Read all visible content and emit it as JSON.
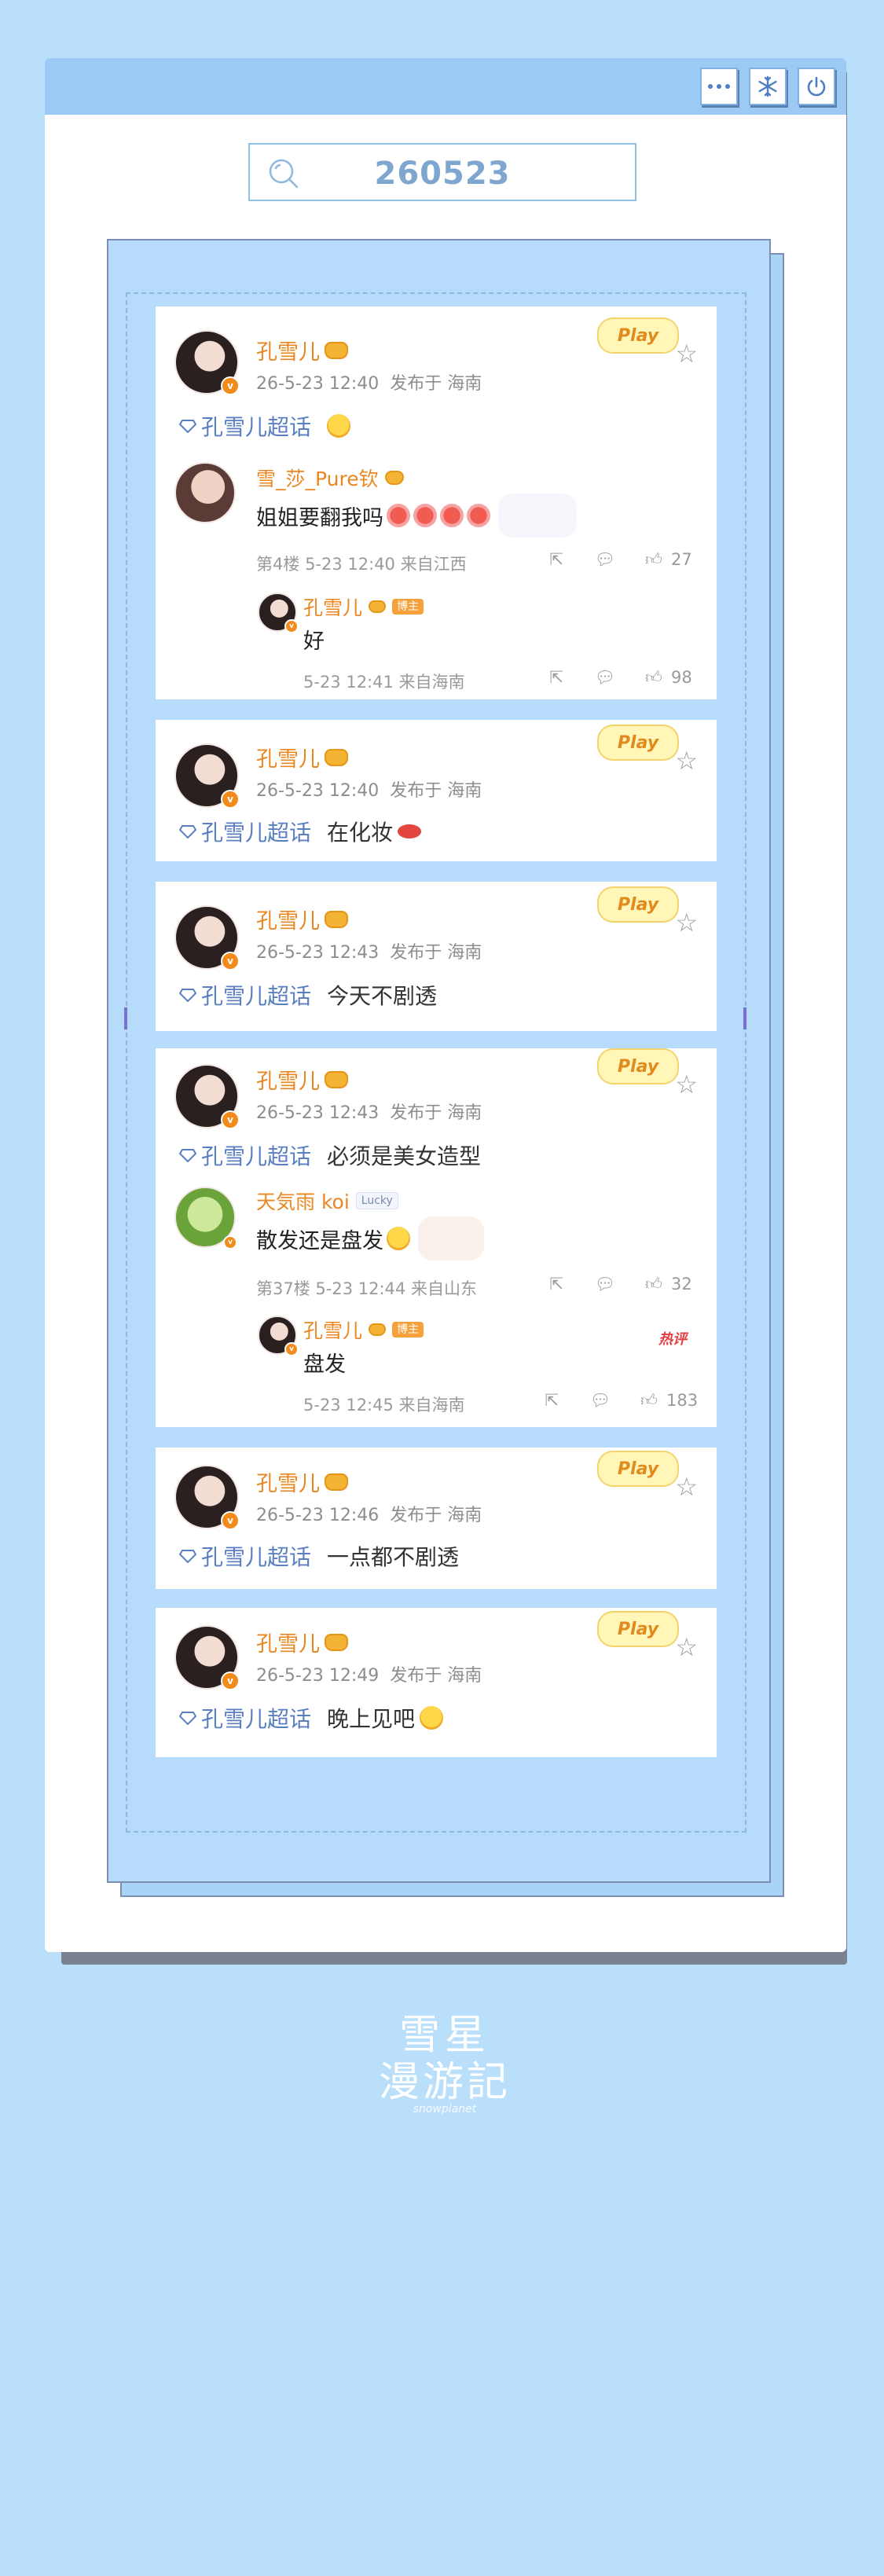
{
  "window": {
    "buttons": [
      "more-icon",
      "snowflake-icon",
      "power-icon"
    ]
  },
  "search": {
    "query": "260523"
  },
  "cards": [
    {
      "user": "孔雪儿",
      "time": "26-5-23 12:40",
      "loc": "发布于 海南",
      "topic": "孔雪儿超话",
      "text": "",
      "sticker": "Play",
      "comment": {
        "user": "雪_莎_Pure钦",
        "text": "姐姐要翻我吗",
        "floor": "第4楼",
        "time": "5-23 12:40",
        "from": "来自江西",
        "likes": "27",
        "reply": {
          "user": "孔雪儿",
          "tag": "博主",
          "text": "好",
          "time": "5-23 12:41",
          "from": "来自海南",
          "likes": "98"
        }
      }
    },
    {
      "user": "孔雪儿",
      "time": "26-5-23 12:40",
      "loc": "发布于 海南",
      "topic": "孔雪儿超话",
      "text": "在化妆",
      "sticker": "Play"
    },
    {
      "user": "孔雪儿",
      "time": "26-5-23 12:43",
      "loc": "发布于 海南",
      "topic": "孔雪儿超话",
      "text": "今天不剧透",
      "sticker": "Play"
    },
    {
      "user": "孔雪儿",
      "time": "26-5-23 12:43",
      "loc": "发布于 海南",
      "topic": "孔雪儿超话",
      "text": "必须是美女造型",
      "sticker": "Play",
      "comment": {
        "user": "天気雨 koi",
        "tag": "Lucky",
        "text": "散发还是盘发",
        "floor": "第37楼",
        "time": "5-23 12:44",
        "from": "来自山东",
        "likes": "32",
        "reply": {
          "user": "孔雪儿",
          "tag": "博主",
          "text": "盘发",
          "hot": "热评",
          "time": "5-23 12:45",
          "from": "来自海南",
          "likes": "183"
        }
      }
    },
    {
      "user": "孔雪儿",
      "time": "26-5-23 12:46",
      "loc": "发布于 海南",
      "topic": "孔雪儿超话",
      "text": "一点都不剧透",
      "sticker": "Play"
    },
    {
      "user": "孔雪儿",
      "time": "26-5-23 12:49",
      "loc": "发布于 海南",
      "topic": "孔雪儿超话",
      "text": "晚上见吧",
      "sticker": "Play"
    }
  ],
  "logo": {
    "line1": "雪星",
    "line2": "漫游記",
    "line3": "snowplanet"
  },
  "colors": {
    "background": "#b9dffa",
    "accent": "#9ccaf5",
    "username": "#e98822",
    "topic": "#5a7fc0"
  }
}
